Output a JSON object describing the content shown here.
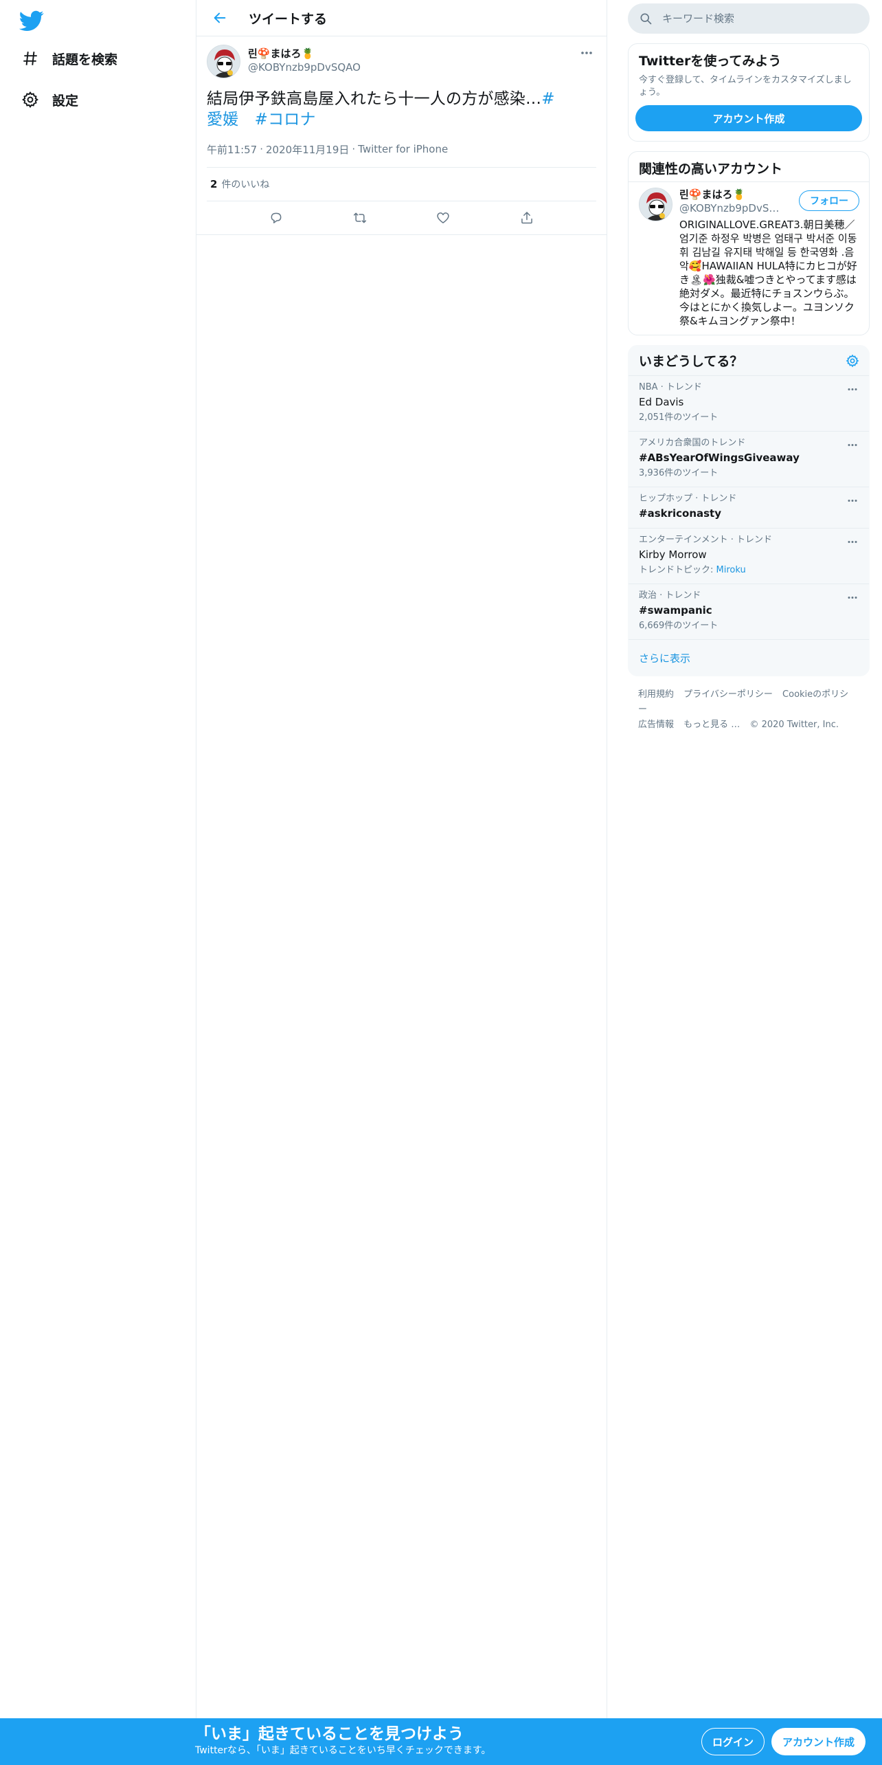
{
  "app": {
    "brand_color": "#1da1f2",
    "logo_icon": "twitter-bird-icon"
  },
  "nav": {
    "items": [
      {
        "label": "話題を検索",
        "icon": "hashtag-icon"
      },
      {
        "label": "設定",
        "icon": "gear-icon"
      }
    ]
  },
  "header": {
    "title": "ツイートする"
  },
  "tweet": {
    "author_name": "린🍄まはろ🍍",
    "author_handle": "@KOBYnzb9pDvSQAO",
    "text_plain": "結局伊予鉄高島屋入れたら十一人の方が感染…",
    "hashtag1": "#愛媛",
    "hashtag2": "#コロナ",
    "time": "午前11:57",
    "date": "2020年11月19日",
    "source": "Twitter for iPhone",
    "likes_count": "2",
    "likes_label": "件のいいね"
  },
  "search": {
    "placeholder": "キーワード検索"
  },
  "signup_card": {
    "title": "Twitterを使ってみよう",
    "desc": "今すぐ登録して、タイムラインをカスタマイズしましょう。",
    "button": "アカウント作成"
  },
  "recommend": {
    "title": "関連性の高いアカウント",
    "name": "린🍄まはろ🍍",
    "handle": "@KOBYnzb9pDvSQAO",
    "follow": "フォロー",
    "bio": "ORIGINALLOVE.GREAT3.朝日美穂／엄기준 하정우 박병은 엄태구 박서준 이동휘 김남길 유지태 박해일 등 한국영화 .음악🥰HAWAIIAN HULA特にカヒコが好き🏝🌺独裁&嘘つきとやってます感は絶対ダメ。最近特にチョスンウらぶ。今はとにかく換気しよー。ユヨンソク祭&キムヨングァン祭中！"
  },
  "trends": {
    "title": "いまどうしてる？",
    "items": [
      {
        "ctx": "NBA · トレンド",
        "name": "Ed Davis",
        "count": "2,051件のツイート",
        "bold": false
      },
      {
        "ctx": "アメリカ合衆国のトレンド",
        "name": "#ABsYearOfWingsGiveaway",
        "count": "3,936件のツイート",
        "bold": true
      },
      {
        "ctx": "ヒップホップ · トレンド",
        "name": "#askriconasty",
        "count": "",
        "bold": true
      },
      {
        "ctx": "エンターテインメント · トレンド",
        "name": "Kirby Morrow",
        "topic_label": "トレンドトピック:",
        "topic": "Miroku",
        "bold": false
      },
      {
        "ctx": "政治 · トレンド",
        "name": "#swampanic",
        "count": "6,669件のツイート",
        "bold": true
      }
    ],
    "show_more": "さらに表示"
  },
  "footer": {
    "links": [
      "利用規約",
      "プライバシーポリシー",
      "Cookieのポリシー",
      "広告情報",
      "もっと見る …"
    ],
    "copyright": "© 2020 Twitter, Inc."
  },
  "bottom_bar": {
    "title": "「いま」起きていることを見つけよう",
    "subtitle": "Twitterなら、「いま」起きていることをいち早くチェックできます。",
    "login": "ログイン",
    "signup": "アカウント作成"
  }
}
